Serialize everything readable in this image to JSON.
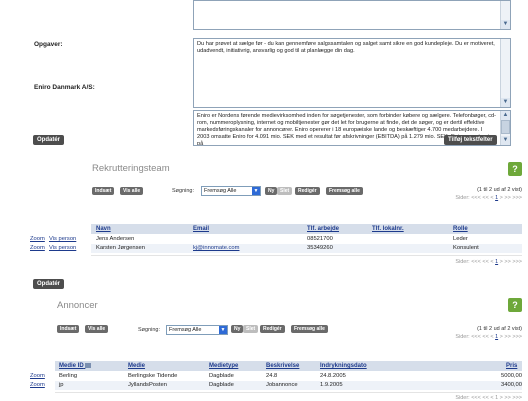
{
  "form": {
    "opgaver_label": "Opgaver:",
    "opgaver_text": "Du har prøvet at sælge før - du kan gennemføre salgssamtalen og salget samt sikre en god kundepleje. Du er motiveret, udadvendt, initiativrig, ansvarlig og god til at planlægge din dag.",
    "eniro_label": "Eniro Danmark A/S:",
    "eniro_text": "Eniro er Nordens førende medievirksomhed inden for søgetjenester, som forbinder købere og sælgere. Telefonbøger, cd-rom, nummeroplysning, internet og mobiltjenester gør det let for brugerne at finde, det de søger, og er dertil effektive markedsføringskanaler for annoncører. Eniro opererer i 18 europæiske lande og beskæftiger 4.700 medarbejdere. I 2003 omsatte Eniro for 4.091 mio. SEK med et resultat før afskrivninger (EBITDA) på 1.279 mio. SEK. Eniro er noteret på",
    "update_label": "Opdatér",
    "add_text_fields_label": "Tilføj tekstfelter"
  },
  "team": {
    "title": "Rekrutteringsteam",
    "help": "?",
    "toolbar": {
      "indsaet": "Indsæt",
      "vis_alle": "Vis alle",
      "search_label": "Søgning:",
      "search_value": "Fremsøg Alle",
      "ny": "Ny",
      "slet": "Slet",
      "rediger": "Redigér",
      "fremsoeg_alle": "Fremsøg alle"
    },
    "count": "(1 til 2 ud af 2 vist)",
    "pager_label": "Sider:",
    "pager_prev": "<<< << <",
    "pager_current": "1",
    "pager_next": "> >> >>>",
    "columns": [
      "Navn",
      "Email",
      "Tlf. arbejde",
      "Tlf. lokalnr.",
      "Rolle"
    ],
    "row_links": {
      "zoom": "Zoom",
      "vis_person": "Vis person"
    },
    "rows": [
      {
        "navn": "Jens Andersen",
        "email": "",
        "tlf": "08521700",
        "lokal": "",
        "rolle": "Leder"
      },
      {
        "navn": "Karsten Jørgensen",
        "email": "kj@innomate.com",
        "tlf": "35349260",
        "lokal": "",
        "rolle": "Konsulent"
      }
    ],
    "update_label": "Opdatér"
  },
  "ads": {
    "title": "Annoncer",
    "help": "?",
    "toolbar": {
      "indsaet": "Indsæt",
      "vis_alle": "Vis alle",
      "search_label": "Søgning:",
      "search_value": "Fremsøg Alle",
      "ny": "Ny",
      "slet": "Slet",
      "rediger": "Redigér",
      "fremsoeg_alle": "Fremsøg alle"
    },
    "count": "(1 til 2 ud af 2 vist)",
    "pager_label": "Sider:",
    "pager_prev": "<<< << <",
    "pager_current": "1",
    "pager_next": "> >> >>>",
    "columns": [
      "Medie ID",
      "Medie",
      "Medietype",
      "Beskrivelse",
      "Indrykningsdato",
      "Pris"
    ],
    "row_links": {
      "zoom": "Zoom"
    },
    "rows": [
      {
        "id": "Berling",
        "medie": "Berlingske Tidende",
        "type": "Dagblade",
        "beskr": "24.8",
        "dato": "24.8.2005",
        "pris": "5000,00"
      },
      {
        "id": "jp",
        "medie": "JyllandsPosten",
        "type": "Dagblade",
        "beskr": "Jobannonce",
        "dato": "1.9.2005",
        "pris": "3400,00"
      }
    ],
    "pager_bottom": "Sider: <<< << < 1 > >> >>>"
  },
  "colors": {
    "accent": "#1d3a8c",
    "header_bg": "#d6deea",
    "button": "#4d4d4d",
    "help": "#6ea83a"
  },
  "icons": {
    "scroll_up": "▲",
    "scroll_down": "▼",
    "select_arrow": "▼",
    "sort": "sort-icon"
  }
}
